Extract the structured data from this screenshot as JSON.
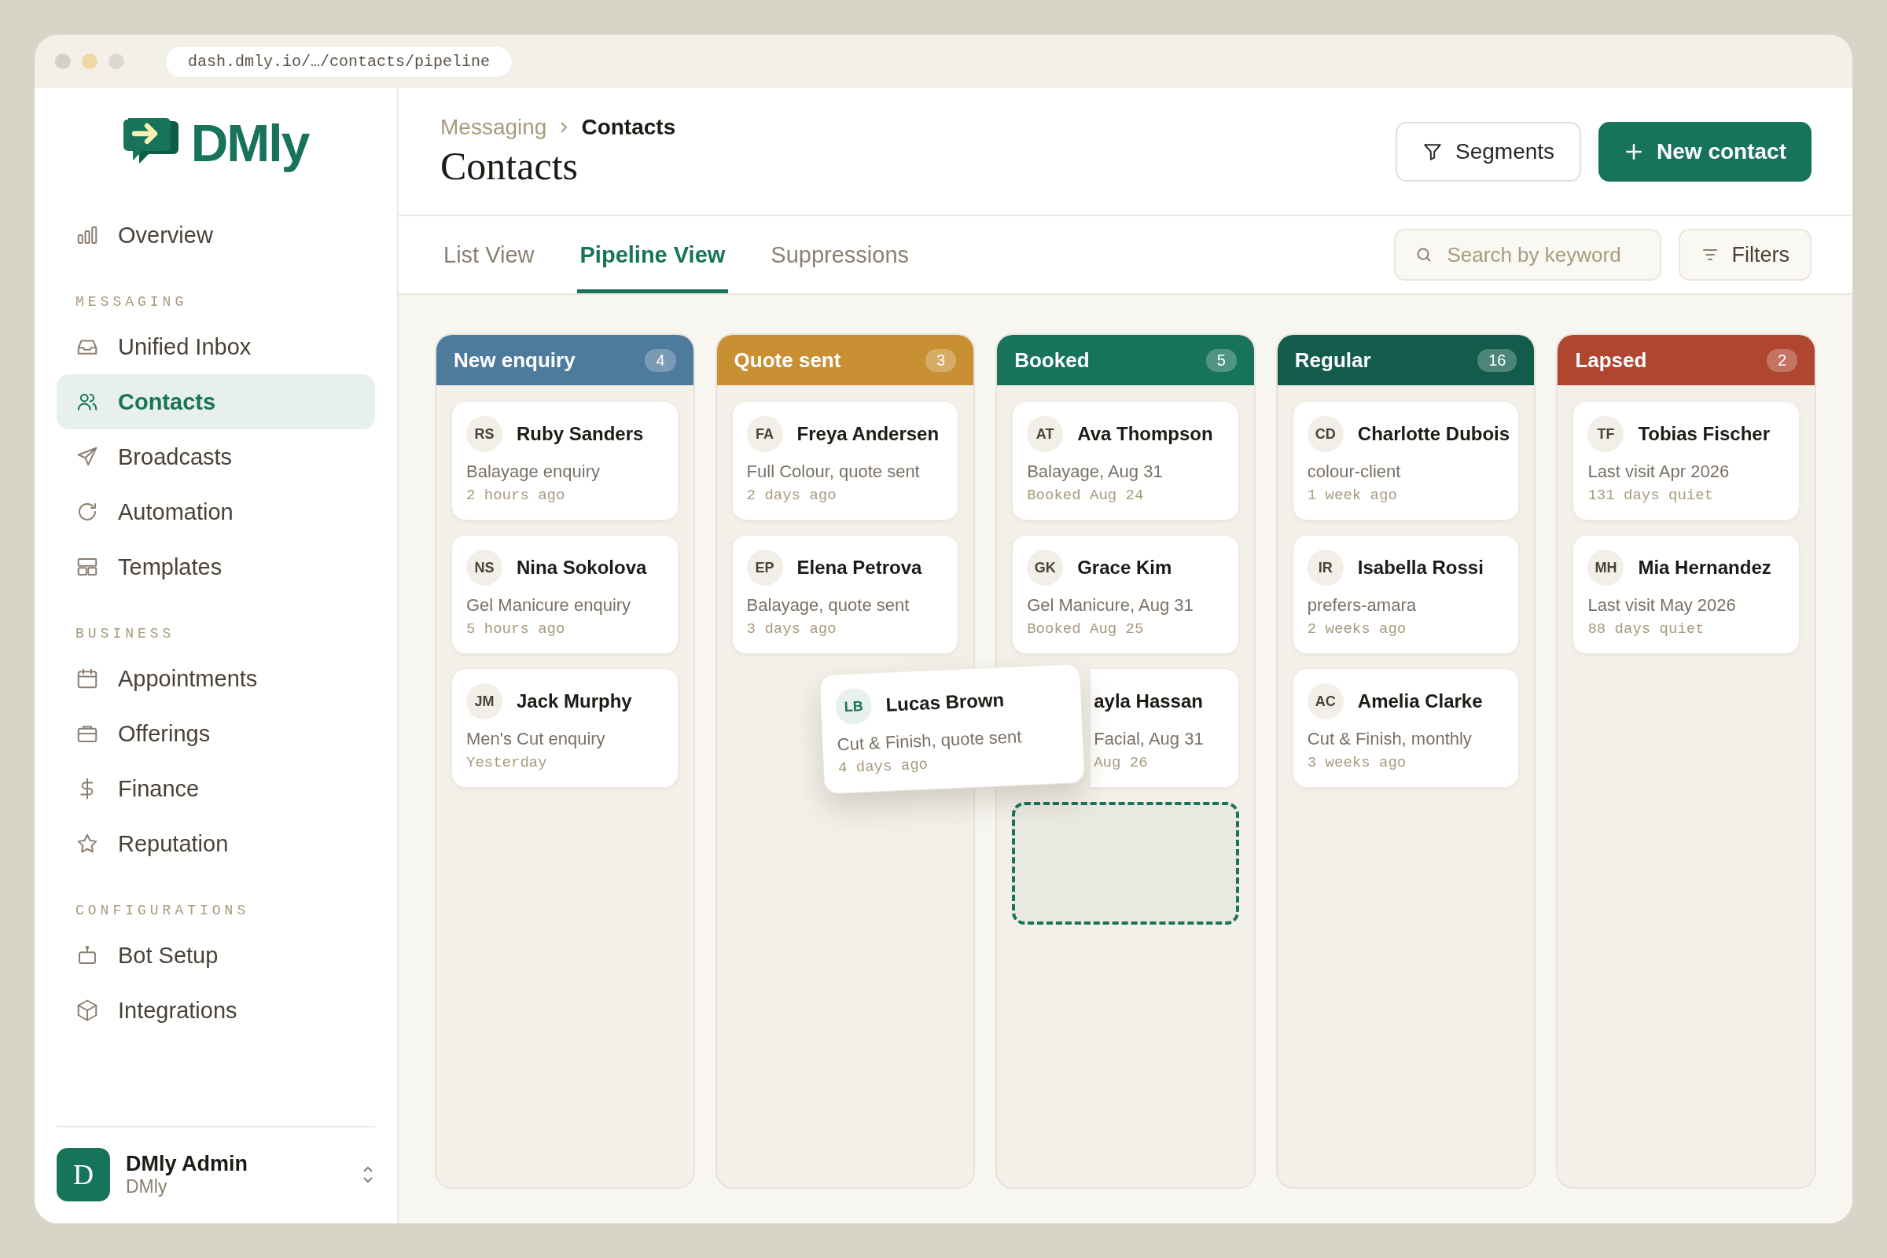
{
  "browser": {
    "url": "dash.dmly.io/…/contacts/pipeline"
  },
  "sidebar": {
    "logo": "DMly",
    "sections": [
      {
        "items": [
          {
            "label": "Overview",
            "selected": false
          }
        ]
      },
      {
        "heading": "MESSAGING",
        "items": [
          {
            "label": "Unified Inbox",
            "selected": false
          },
          {
            "label": "Contacts",
            "selected": true
          },
          {
            "label": "Broadcasts",
            "selected": false
          },
          {
            "label": "Automation",
            "selected": false
          },
          {
            "label": "Templates",
            "selected": false
          }
        ]
      },
      {
        "heading": "BUSINESS",
        "items": [
          {
            "label": "Appointments",
            "selected": false
          },
          {
            "label": "Offerings",
            "selected": false
          },
          {
            "label": "Finance",
            "selected": false
          },
          {
            "label": "Reputation",
            "selected": false
          }
        ]
      },
      {
        "heading": "CONFIGURATIONS",
        "items": [
          {
            "label": "Bot Setup",
            "selected": false
          },
          {
            "label": "Integrations",
            "selected": false
          }
        ]
      }
    ],
    "user": {
      "initial": "D",
      "name": "DMly Admin",
      "org": "DMly"
    }
  },
  "header": {
    "breadcrumb": [
      "Messaging",
      "Contacts"
    ],
    "title": "Contacts",
    "buttons": [
      {
        "label": "Segments",
        "kind": "secondary"
      },
      {
        "label": "New contact",
        "kind": "primary"
      }
    ]
  },
  "tabs": [
    {
      "label": "List View",
      "selected": false
    },
    {
      "label": "Pipeline View",
      "selected": true
    },
    {
      "label": "Suppressions",
      "selected": false
    }
  ],
  "search": {
    "placeholder": "Search by keyword"
  },
  "filters_button": "Filters",
  "columns": [
    {
      "title": "New enquiry",
      "count": "4",
      "color": "#4e7a9c",
      "cards": [
        {
          "kind": "card",
          "initials": "RS",
          "name": "Ruby Sanders",
          "detail": "Balayage enquiry",
          "time": "2 hours ago"
        },
        {
          "kind": "card",
          "initials": "NS",
          "name": "Nina Sokolova",
          "detail": "Gel Manicure enquiry",
          "time": "5 hours ago"
        },
        {
          "kind": "card",
          "initials": "JM",
          "name": "Jack Murphy",
          "detail": "Men's Cut enquiry",
          "time": "Yesterday"
        }
      ]
    },
    {
      "title": "Quote sent",
      "count": "3",
      "color": "#c98f33",
      "cards": [
        {
          "kind": "card",
          "initials": "FA",
          "name": "Freya Andersen",
          "detail": "Full Colour, quote sent",
          "time": "2 days ago"
        },
        {
          "kind": "card",
          "initials": "EP",
          "name": "Elena Petrova",
          "detail": "Balayage, quote sent",
          "time": "3 days ago"
        }
      ]
    },
    {
      "title": "Booked",
      "count": "5",
      "color": "#17735a",
      "cards": [
        {
          "kind": "card",
          "initials": "AT",
          "name": "Ava Thompson",
          "detail": "Balayage, Aug 31",
          "time": "Booked Aug 24"
        },
        {
          "kind": "card",
          "initials": "GK",
          "name": "Grace Kim",
          "detail": "Gel Manicure, Aug 31",
          "time": "Booked Aug 25"
        },
        {
          "kind": "covered",
          "name": "ayla Hassan",
          "detail": "Facial, Aug 31",
          "time": "Aug 26"
        },
        {
          "kind": "drop_zone"
        }
      ]
    },
    {
      "title": "Regular",
      "count": "16",
      "color": "#135c4c",
      "cards": [
        {
          "kind": "card",
          "initials": "CD",
          "name": "Charlotte Dubois",
          "detail": "colour-client",
          "time": "1 week ago"
        },
        {
          "kind": "card",
          "initials": "IR",
          "name": "Isabella Rossi",
          "detail": "prefers-amara",
          "time": "2 weeks ago"
        },
        {
          "kind": "card",
          "initials": "AC",
          "name": "Amelia Clarke",
          "detail": "Cut & Finish, monthly",
          "time": "3 weeks ago"
        }
      ]
    },
    {
      "title": "Lapsed",
      "count": "2",
      "color": "#b0462f",
      "cards": [
        {
          "kind": "card",
          "initials": "TF",
          "name": "Tobias Fischer",
          "detail": "Last visit Apr 2026",
          "time": "131 days quiet"
        },
        {
          "kind": "card",
          "initials": "MH",
          "name": "Mia Hernandez",
          "detail": "Last visit May 2026",
          "time": "88 days quiet"
        }
      ]
    }
  ],
  "dragged_card": {
    "initials": "LB",
    "name": "Lucas Brown",
    "detail": "Cut & Finish, quote sent",
    "time": "4 days ago"
  }
}
